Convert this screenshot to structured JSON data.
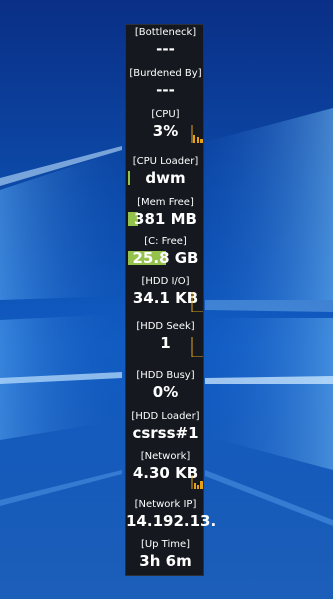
{
  "colors": {
    "panel_bg": "#15191f",
    "text": "#ffffff",
    "spark": "#e3a21a",
    "bar": "#95c24d"
  },
  "metrics": [
    {
      "label": "[Bottleneck]",
      "value": "---"
    },
    {
      "label": "[Burdened By]",
      "value": "---"
    },
    {
      "label": "[CPU]",
      "value": "3%"
    },
    {
      "label": "[CPU Loader]",
      "value": "dwm"
    },
    {
      "label": "[Mem Free]",
      "value": "381 MB"
    },
    {
      "label": "[C: Free]",
      "value": "25.8 GB"
    },
    {
      "label": "[HDD I/O]",
      "value": "34.1 KB"
    },
    {
      "label": "[HDD Seek]",
      "value": "1"
    },
    {
      "label": "[HDD Busy]",
      "value": "0%"
    },
    {
      "label": "[HDD Loader]",
      "value": "csrss#1"
    },
    {
      "label": "[Network]",
      "value": "4.30 KB"
    },
    {
      "label": "[Network IP]",
      "value": "14.192.13."
    },
    {
      "label": "[Up Time]",
      "value": "3h 6m"
    }
  ]
}
